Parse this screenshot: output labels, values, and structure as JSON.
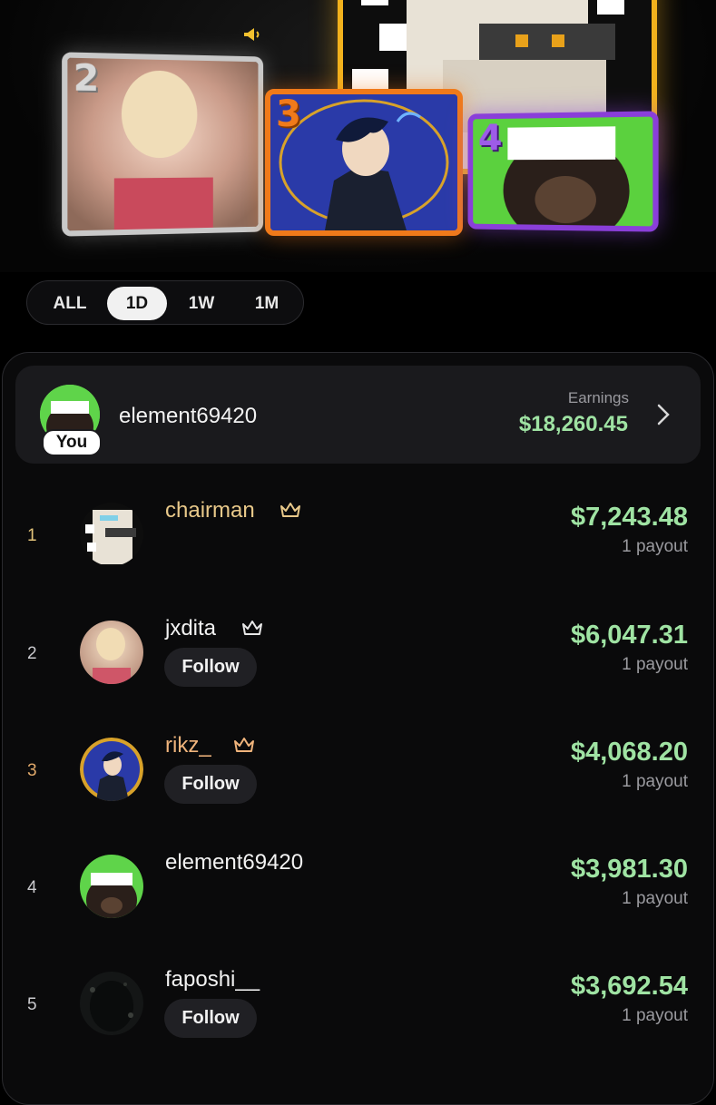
{
  "filters": {
    "options": [
      "ALL",
      "1D",
      "1W",
      "1M"
    ],
    "selected": "1D"
  },
  "podium": {
    "cards": [
      {
        "rank": "2",
        "user": "jxdita",
        "frame_color": "#c9c9c9"
      },
      {
        "rank": "3",
        "user": "rikz_",
        "frame_color": "#f07a1a"
      },
      {
        "rank": "4",
        "user": "element69420",
        "frame_color": "#8a3fd9"
      }
    ],
    "first_frame_color": "#f2b21d"
  },
  "current_user": {
    "username": "element69420",
    "badge": "You",
    "earnings_label": "Earnings",
    "earnings": "$18,260.45"
  },
  "leaderboard": [
    {
      "rank": "1",
      "username": "chairman",
      "amount": "$7,243.48",
      "payouts": "1 payout",
      "crown": true,
      "follow": null
    },
    {
      "rank": "2",
      "username": "jxdita",
      "amount": "$6,047.31",
      "payouts": "1 payout",
      "crown": true,
      "follow": "Follow"
    },
    {
      "rank": "3",
      "username": "rikz_",
      "amount": "$4,068.20",
      "payouts": "1 payout",
      "crown": true,
      "follow": "Follow"
    },
    {
      "rank": "4",
      "username": "element69420",
      "amount": "$3,981.30",
      "payouts": "1 payout",
      "crown": false,
      "follow": null
    },
    {
      "rank": "5",
      "username": "faposhi__",
      "amount": "$3,692.54",
      "payouts": "1 payout",
      "crown": false,
      "follow": "Follow"
    }
  ],
  "colors": {
    "earnings_green": "#9fe3a3",
    "background": "#000000",
    "rank1_text": "#e9c98a",
    "rank3_text": "#f0b47c"
  },
  "icons": {
    "announcement": "megaphone-icon",
    "crown": "crown-icon",
    "chevron": "chevron-right-icon"
  }
}
